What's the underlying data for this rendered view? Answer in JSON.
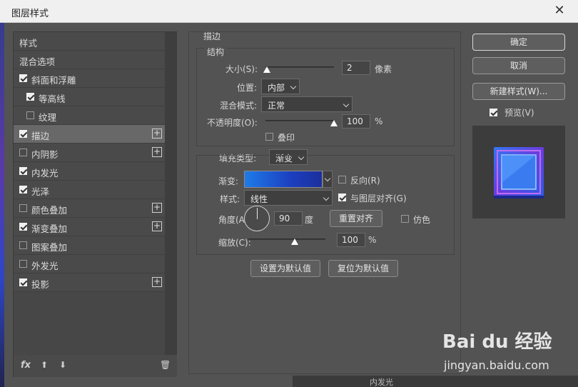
{
  "window": {
    "title": "图层样式",
    "close_glyph": "✕"
  },
  "left_panel": {
    "items": [
      {
        "label": "样式",
        "checkbox": null,
        "plus": false,
        "selected": false,
        "indent": 0
      },
      {
        "label": "混合选项",
        "checkbox": null,
        "plus": false,
        "selected": false,
        "indent": 0
      },
      {
        "label": "斜面和浮雕",
        "checkbox": true,
        "plus": false,
        "selected": false,
        "indent": 0
      },
      {
        "label": "等高线",
        "checkbox": true,
        "plus": false,
        "selected": false,
        "indent": 1
      },
      {
        "label": "纹理",
        "checkbox": false,
        "plus": false,
        "selected": false,
        "indent": 1
      },
      {
        "label": "描边",
        "checkbox": true,
        "plus": true,
        "selected": true,
        "indent": 0
      },
      {
        "label": "内阴影",
        "checkbox": false,
        "plus": true,
        "selected": false,
        "indent": 0
      },
      {
        "label": "内发光",
        "checkbox": true,
        "plus": false,
        "selected": false,
        "indent": 0
      },
      {
        "label": "光泽",
        "checkbox": true,
        "plus": false,
        "selected": false,
        "indent": 0
      },
      {
        "label": "颜色叠加",
        "checkbox": false,
        "plus": true,
        "selected": false,
        "indent": 0
      },
      {
        "label": "渐变叠加",
        "checkbox": true,
        "plus": true,
        "selected": false,
        "indent": 0
      },
      {
        "label": "图案叠加",
        "checkbox": false,
        "plus": false,
        "selected": false,
        "indent": 0
      },
      {
        "label": "外发光",
        "checkbox": false,
        "plus": false,
        "selected": false,
        "indent": 0
      },
      {
        "label": "投影",
        "checkbox": true,
        "plus": true,
        "selected": false,
        "indent": 0
      }
    ],
    "fx_label": "fx",
    "plus_glyph": "+",
    "up_glyph": "⬆",
    "down_glyph": "⬇",
    "trash_glyph": "🗑"
  },
  "stroke": {
    "section_title": "描边",
    "structure_title": "结构",
    "size_label": "大小(S):",
    "size_value": "2",
    "size_unit": "像素",
    "size_slider_fraction": 0.02,
    "position_label": "位置:",
    "position_value": "内部",
    "blend_label": "混合模式:",
    "blend_value": "正常",
    "opacity_label": "不透明度(O):",
    "opacity_value": "100",
    "opacity_unit": "%",
    "opacity_slider_fraction": 1.0,
    "overprint_label": "叠印",
    "overprint_checked": false,
    "fill_type_label": "填充类型:",
    "fill_type_value": "渐变",
    "gradient_label": "渐变:",
    "reverse_label": "反向(R)",
    "reverse_checked": false,
    "style_label": "样式:",
    "style_value": "线性",
    "align_label": "与图层对齐(G)",
    "align_checked": true,
    "angle_label": "角度(A):",
    "angle_value": "90",
    "angle_unit": "度",
    "reset_align_label": "重置对齐",
    "dither_label": "仿色",
    "dither_checked": false,
    "scale_label": "缩放(C):",
    "scale_value": "100",
    "scale_unit": "%",
    "scale_slider_fraction": 0.6,
    "set_default_label": "设置为默认值",
    "reset_default_label": "复位为默认值"
  },
  "right": {
    "ok_label": "确定",
    "cancel_label": "取消",
    "new_style_label": "新建样式(W)...",
    "preview_label": "预览(V)",
    "preview_checked": true
  },
  "background": {
    "behind_text": "内发光"
  },
  "watermark": {
    "brand": "Bai du 经验",
    "url": "jingyan.baidu.com"
  },
  "colors": {
    "panel": "#535353",
    "selected_row": "#686868",
    "gradient_start": "#1e7be8",
    "gradient_end": "#1b2f9b"
  }
}
